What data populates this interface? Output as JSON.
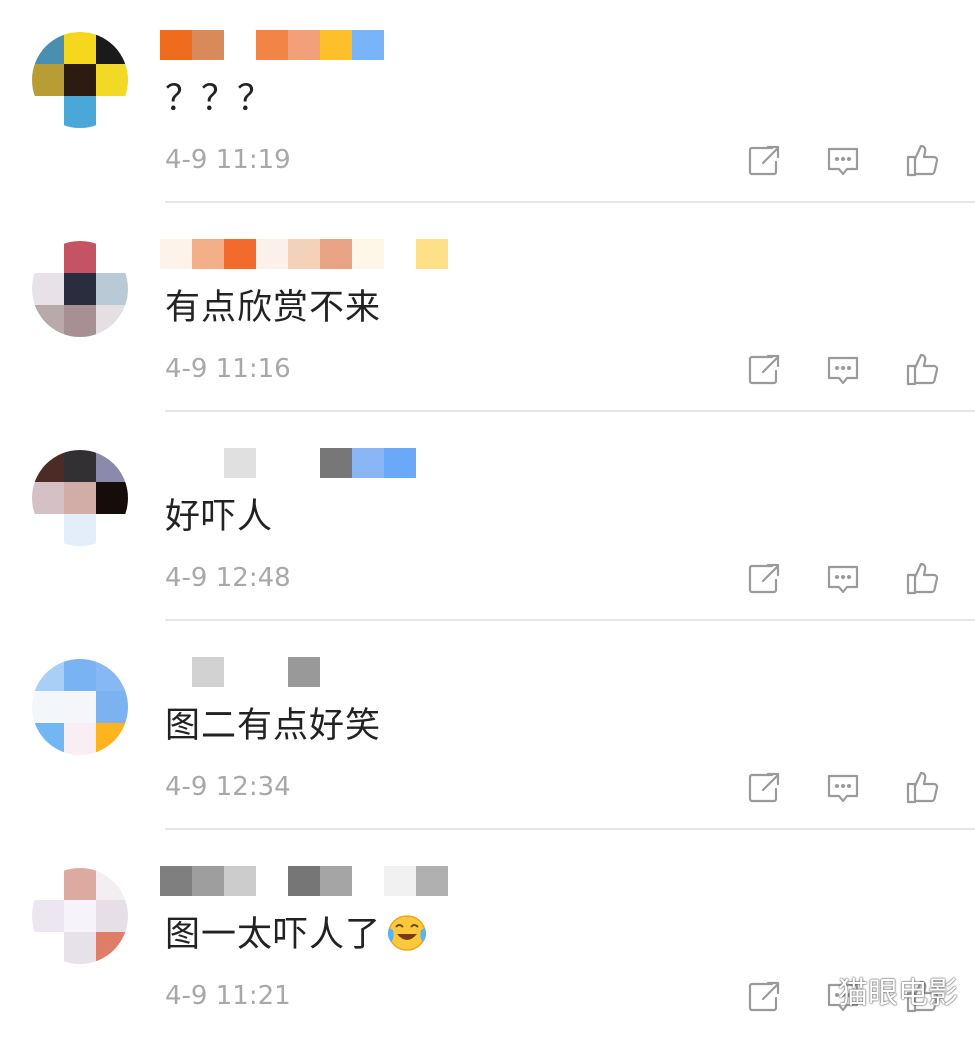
{
  "comments": [
    {
      "text": "？？？",
      "time": "4-9 11:19",
      "has_emoji": false,
      "avatar_colors": [
        "#4a8fb0",
        "#f5d81e",
        "#1a1a1a",
        "#b89d34",
        "#2b1b10",
        "#f2d926",
        "#ffffff",
        "#4aa8d8",
        "#ffffff"
      ],
      "name_colors": [
        "#ef6b1e",
        "#d98a5a",
        "#ffffff",
        "#f28448",
        "#f2a07a",
        "#fdc02a",
        "#7ab4f8"
      ]
    },
    {
      "text": "有点欣赏不来",
      "time": "4-9 11:16",
      "has_emoji": false,
      "avatar_colors": [
        "#ffffff",
        "#c45464",
        "#ffffff",
        "#e8e2e8",
        "#292e3e",
        "#b9cad6",
        "#b8a9ab",
        "#a88f93",
        "#e4dfe2"
      ],
      "name_colors": [
        "#fdf3ea",
        "#f3b088",
        "#f26b2c",
        "#fcf1ea",
        "#f4d2b9",
        "#e9a385",
        "#fef7e8",
        "#ffffff",
        "#fde088"
      ]
    },
    {
      "text": "好吓人",
      "time": "4-9 12:48",
      "has_emoji": false,
      "avatar_colors": [
        "#4c2a26",
        "#323033",
        "#8b8aac",
        "#d4c1c6",
        "#d2aca6",
        "#160d0a",
        "#ffffff",
        "#e4eefa",
        "#ffffff"
      ],
      "name_colors": [
        "#ffffff",
        "#ffffff",
        "#e0e0e0",
        "#ffffff",
        "#ffffff",
        "#777777",
        "#8ab6f5",
        "#6aa8f8"
      ]
    },
    {
      "text": "图二有点好笑",
      "time": "4-9 12:34",
      "has_emoji": false,
      "avatar_colors": [
        "#a8cff6",
        "#79b3f3",
        "#86b8f5",
        "#f3f7fb",
        "#f5f6f9",
        "#7db2f0",
        "#72b6f3",
        "#f9eef3",
        "#feb41e"
      ],
      "name_colors": [
        "#ffffff",
        "#d2d2d2",
        "#ffffff",
        "#ffffff",
        "#999999"
      ]
    },
    {
      "text": "图一太吓人了",
      "time": "4-9 11:21",
      "has_emoji": true,
      "avatar_colors": [
        "#ffffff",
        "#ddaaa2",
        "#f3eef2",
        "#ece6f0",
        "#f6f3fb",
        "#e6dfe7",
        "#ffffff",
        "#e7e1ea",
        "#df7e68"
      ],
      "name_colors": [
        "#7f7f7f",
        "#9e9e9e",
        "#cccccc",
        "#ffffff",
        "#767676",
        "#a5a5a5",
        "#ffffff",
        "#f1f1f1",
        "#b0b0b0"
      ]
    }
  ],
  "icons": {
    "share": "share-icon",
    "reply": "comment-icon",
    "like": "thumbs-up-icon",
    "emoji": "laughing-crying-emoji"
  },
  "icon_color": "#9a9a9a",
  "watermark": "猫眼电影"
}
